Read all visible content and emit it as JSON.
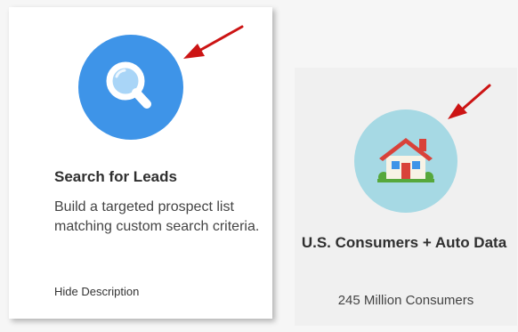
{
  "cards": [
    {
      "title": "Search for Leads",
      "description": "Build a targeted prospect list matching custom search criteria.",
      "toggle_label": "Hide Description",
      "icon": "search-icon",
      "icon_bg": "#3e94e8"
    },
    {
      "title": "U.S. Consumers + Auto Data",
      "subtitle": "245 Million Consumers",
      "icon": "house-icon",
      "icon_bg": "#a6d9e4"
    }
  ],
  "annotation_color": "#cc1414"
}
